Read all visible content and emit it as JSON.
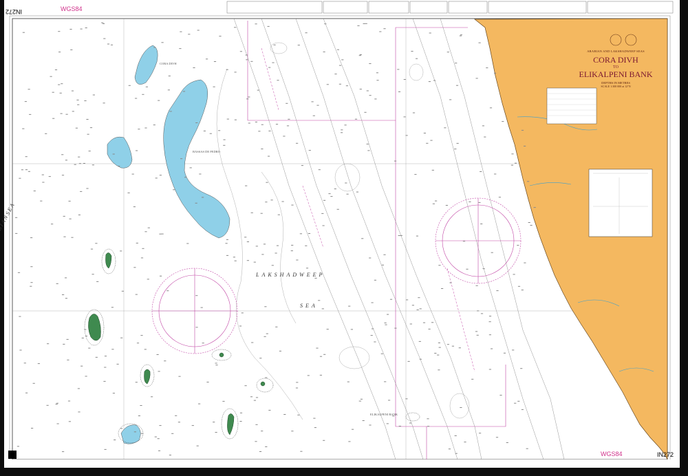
{
  "chart": {
    "number": "IN272",
    "datum": "WGS84",
    "region_heading": "ARABIAN AND LAKSHADWEEP SEAS",
    "title_line1": "CORA DIVH",
    "title_line2": "TO",
    "title_line3": "ELIKALPENI BANK",
    "depths_note": "DEPTHS IN METRES",
    "scale_note": "SCALE 1:300 000 at 12°N"
  },
  "places": {
    "cora_divh": "CORA DIVH",
    "bassas_de_pedro": "BASSAS DE PEDRO",
    "sea_name_1": "LAKSHADWEEP",
    "sea_name_2": "SEA",
    "arabian_sea": "A R A B I A N     S E A",
    "elikalpeni_bank": "ELIKALPENI BANK"
  },
  "colors": {
    "paper": "#ffffff",
    "land": "#f4b860",
    "shallow_water": "#8fd0e8",
    "island_green": "#3f8a4f",
    "compass_magenta": "#c247a6",
    "border": "#0d0d0d"
  }
}
